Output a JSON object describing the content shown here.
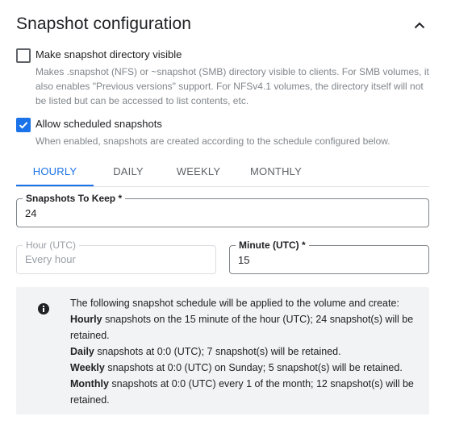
{
  "section": {
    "title": "Snapshot configuration",
    "collapse_icon": "chevron-up-icon"
  },
  "options": {
    "visible_dir": {
      "label": "Make snapshot directory visible",
      "checked": false,
      "description": "Makes .snapshot (NFS) or ~snapshot (SMB) directory visible to clients. For SMB volumes, it also enables \"Previous versions\" support. For NFSv4.1 volumes, the directory itself will not be listed but can be accessed to list contents, etc."
    },
    "scheduled": {
      "label": "Allow scheduled snapshots",
      "checked": true,
      "description": "When enabled, snapshots are created according to the schedule configured below."
    }
  },
  "tabs": [
    {
      "label": "HOURLY",
      "active": true
    },
    {
      "label": "DAILY",
      "active": false
    },
    {
      "label": "WEEKLY",
      "active": false
    },
    {
      "label": "MONTHLY",
      "active": false
    }
  ],
  "fields": {
    "snapshots_to_keep": {
      "label": "Snapshots To Keep *",
      "value": "24"
    },
    "hour": {
      "label": "Hour (UTC)",
      "placeholder": "Every hour",
      "disabled": true
    },
    "minute": {
      "label": "Minute (UTC) *",
      "value": "15"
    }
  },
  "info": {
    "icon": "info-icon",
    "intro": "The following snapshot schedule will be applied to the volume and create:",
    "lines": [
      {
        "bold": "Hourly",
        "text": " snapshots on the 15 minute of the hour (UTC); 24 snapshot(s) will be retained."
      },
      {
        "bold": "Daily",
        "text": " snapshots at 0:0 (UTC); 7 snapshot(s) will be retained."
      },
      {
        "bold": "Weekly",
        "text": " snapshots at 0:0 (UTC) on Sunday; 5 snapshot(s) will be retained."
      },
      {
        "bold": "Monthly",
        "text": " snapshots at 0:0 (UTC) every 1 of the month; 12 snapshot(s) will be retained."
      }
    ]
  },
  "colors": {
    "accent": "#1a73e8",
    "info_bg": "#f1f3f4",
    "muted_text": "#80868b"
  }
}
